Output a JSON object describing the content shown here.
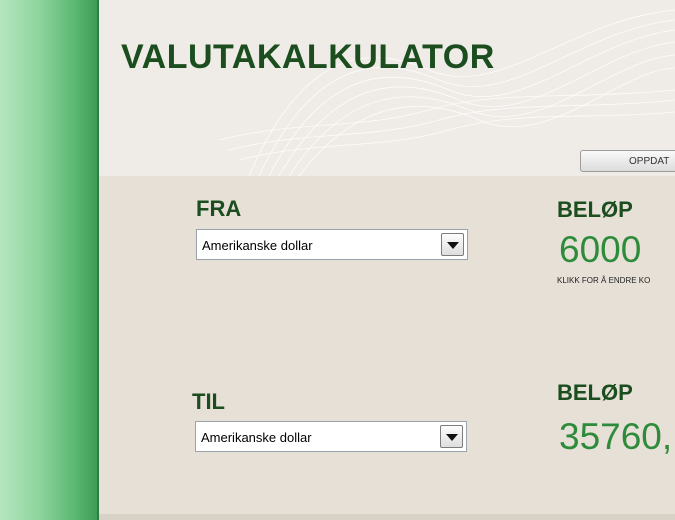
{
  "title": "VALUTAKALKULATOR",
  "update_button": "OPPDAT",
  "from": {
    "heading": "FRA",
    "currency": "Amerikanske dollar",
    "amount_heading": "BELØP",
    "amount": "6000",
    "hint": "KLIKK FOR Å ENDRE KO"
  },
  "to": {
    "heading": "TIL",
    "currency": "Amerikanske dollar",
    "amount_heading": "BELØP",
    "amount": "35760,"
  },
  "colors": {
    "title": "#1b4d1f",
    "amount": "#2e8b3a",
    "sidebar": "#5cb873"
  }
}
